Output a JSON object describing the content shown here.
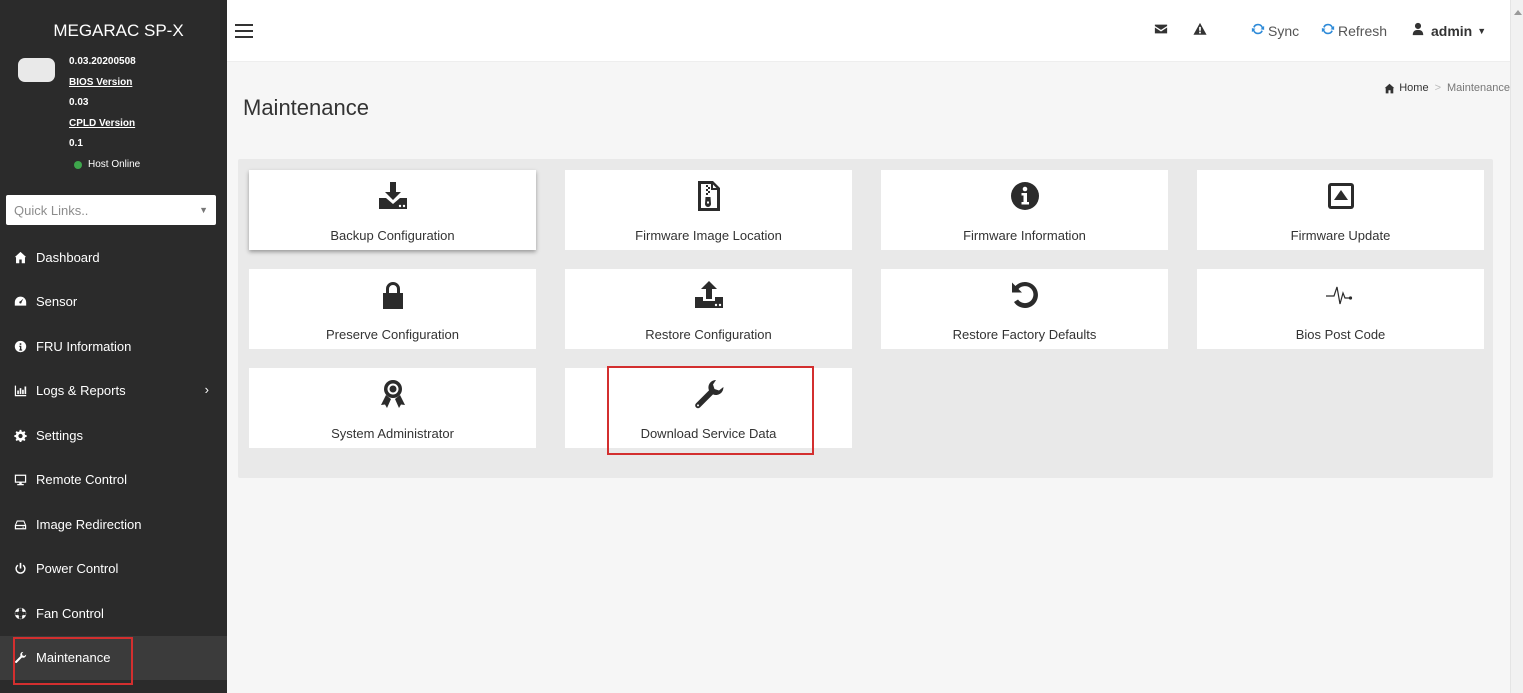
{
  "app": {
    "brand": "MEGARAC SP-X"
  },
  "userpanel": {
    "fw_version": "0.03.20200508",
    "bios_label": "BIOS Version",
    "bios_value": "0.03",
    "cpld_label": "CPLD Version",
    "cpld_value": "0.1",
    "host_status": "Host Online",
    "status_color": "#3ea64c"
  },
  "quicklinks": {
    "placeholder": "Quick Links.."
  },
  "sidebar": {
    "items": [
      {
        "label": "Dashboard",
        "icon": "home-icon"
      },
      {
        "label": "Sensor",
        "icon": "tachometer-icon"
      },
      {
        "label": "FRU Information",
        "icon": "info-circle-icon"
      },
      {
        "label": "Logs & Reports",
        "icon": "bar-chart-icon"
      },
      {
        "label": "Settings",
        "icon": "gear-icon"
      },
      {
        "label": "Remote Control",
        "icon": "monitor-icon"
      },
      {
        "label": "Image Redirection",
        "icon": "drive-icon"
      },
      {
        "label": "Power Control",
        "icon": "power-icon"
      },
      {
        "label": "Fan Control",
        "icon": "life-ring-icon"
      },
      {
        "label": "Maintenance",
        "icon": "wrench-icon"
      }
    ]
  },
  "header": {
    "sync_label": "Sync",
    "refresh_label": "Refresh",
    "user_label": "admin",
    "accent_color": "#2d8ad8"
  },
  "page": {
    "title": "Maintenance",
    "breadcrumb_home": "Home",
    "breadcrumb_current": "Maintenance"
  },
  "cards": [
    {
      "label": "Backup Configuration",
      "icon": "download-icon"
    },
    {
      "label": "Firmware Image Location",
      "icon": "zip-file-icon"
    },
    {
      "label": "Firmware Information",
      "icon": "info-icon"
    },
    {
      "label": "Firmware Update",
      "icon": "eject-icon"
    },
    {
      "label": "Preserve Configuration",
      "icon": "lock-icon"
    },
    {
      "label": "Restore Configuration",
      "icon": "upload-icon"
    },
    {
      "label": "Restore Factory Defaults",
      "icon": "undo-icon"
    },
    {
      "label": "Bios Post Code",
      "icon": "pulse-icon"
    },
    {
      "label": "System Administrator",
      "icon": "award-icon"
    },
    {
      "label": "Download Service Data",
      "icon": "wrench-icon"
    }
  ],
  "highlight_color": "#d32f2f"
}
